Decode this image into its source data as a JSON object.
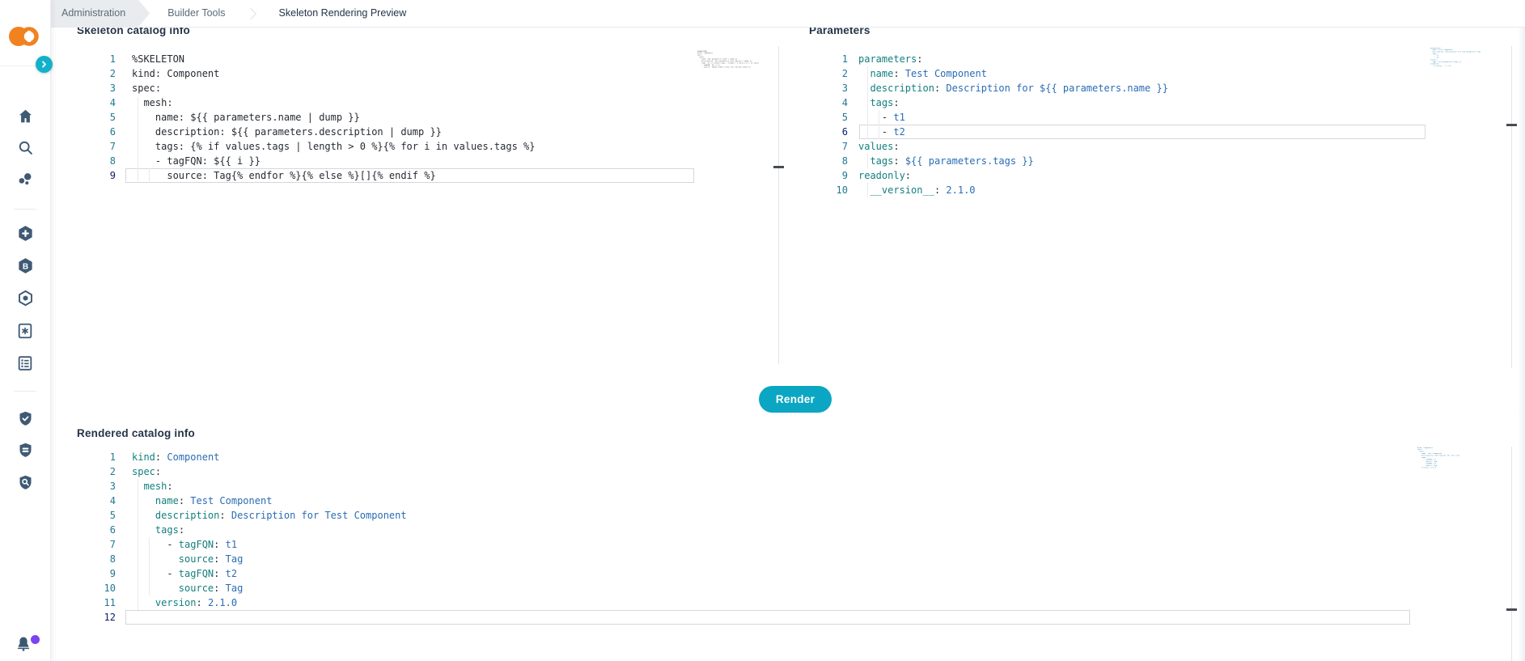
{
  "breadcrumb": {
    "items": [
      "Administration",
      "Builder Tools",
      "Skeleton Rendering Preview"
    ]
  },
  "sidebar": {
    "icons": [
      "logo",
      "collapse-chevron",
      "home",
      "search",
      "cluster",
      "hexagon-plus",
      "hexagon-b",
      "hexagon-outline",
      "card-gear",
      "card-list",
      "shield-check",
      "shield-data",
      "shield-search",
      "notifications-bell"
    ],
    "notification_dot_color": "#7c42f5"
  },
  "toolbar": {
    "render_label": "Render"
  },
  "colors": {
    "accent_teal": "#0ba6c3",
    "logo_orange": "#f08220",
    "yaml_key": "#147e7e",
    "yaml_value": "#2a6cb5",
    "plain_code": "#262b33",
    "line_number": "#237893",
    "active_line_number": "#0b216f"
  },
  "editors": {
    "skeleton": {
      "title": "Skeleton catalog info",
      "active_line": 9,
      "lines": [
        {
          "n": 1,
          "s": [
            [
              "p",
              "%SKELETON"
            ]
          ]
        },
        {
          "n": 2,
          "s": [
            [
              "p",
              "kind: Component"
            ]
          ]
        },
        {
          "n": 3,
          "s": [
            [
              "p",
              "spec:"
            ]
          ]
        },
        {
          "n": 4,
          "s": [
            [
              "p",
              "  mesh:"
            ]
          ]
        },
        {
          "n": 5,
          "s": [
            [
              "p",
              "    name: ${{ parameters.name | dump }}"
            ]
          ]
        },
        {
          "n": 6,
          "s": [
            [
              "p",
              "    description: ${{ parameters.description | dump }}"
            ]
          ]
        },
        {
          "n": 7,
          "s": [
            [
              "p",
              "    tags: {% if values.tags | length > 0 %}{% for i in values.tags %}"
            ]
          ]
        },
        {
          "n": 8,
          "s": [
            [
              "p",
              "    - tagFQN: ${{ i }}"
            ]
          ]
        },
        {
          "n": 9,
          "s": [
            [
              "p",
              "      source: Tag{% endfor %}{% else %}[]{% endif %}"
            ]
          ]
        }
      ]
    },
    "parameters": {
      "title": "Parameters",
      "active_line": 6,
      "lines": [
        {
          "n": 1,
          "s": [
            [
              "k",
              "parameters"
            ],
            [
              "p",
              ":"
            ]
          ]
        },
        {
          "n": 2,
          "s": [
            [
              "p",
              "  "
            ],
            [
              "k",
              "name"
            ],
            [
              "p",
              ":"
            ],
            [
              "v",
              " Test Component"
            ]
          ]
        },
        {
          "n": 3,
          "s": [
            [
              "p",
              "  "
            ],
            [
              "k",
              "description"
            ],
            [
              "p",
              ":"
            ],
            [
              "v",
              " Description for ${{ parameters.name }}"
            ]
          ]
        },
        {
          "n": 4,
          "s": [
            [
              "p",
              "  "
            ],
            [
              "k",
              "tags"
            ],
            [
              "p",
              ":"
            ]
          ]
        },
        {
          "n": 5,
          "s": [
            [
              "p",
              "    - "
            ],
            [
              "v",
              "t1"
            ]
          ]
        },
        {
          "n": 6,
          "s": [
            [
              "p",
              "    - "
            ],
            [
              "v",
              "t2"
            ]
          ]
        },
        {
          "n": 7,
          "s": [
            [
              "k",
              "values"
            ],
            [
              "p",
              ":"
            ]
          ]
        },
        {
          "n": 8,
          "s": [
            [
              "p",
              "  "
            ],
            [
              "k",
              "tags"
            ],
            [
              "p",
              ":"
            ],
            [
              "v",
              " ${{ parameters.tags }}"
            ]
          ]
        },
        {
          "n": 9,
          "s": [
            [
              "k",
              "readonly"
            ],
            [
              "p",
              ":"
            ]
          ]
        },
        {
          "n": 10,
          "s": [
            [
              "p",
              "  "
            ],
            [
              "k",
              "__version__"
            ],
            [
              "p",
              ":"
            ],
            [
              "v",
              " 2.1.0"
            ]
          ]
        }
      ]
    },
    "rendered": {
      "title": "Rendered catalog info",
      "active_line": 12,
      "lines": [
        {
          "n": 1,
          "s": [
            [
              "k",
              "kind"
            ],
            [
              "p",
              ":"
            ],
            [
              "v",
              " Component"
            ]
          ]
        },
        {
          "n": 2,
          "s": [
            [
              "k",
              "spec"
            ],
            [
              "p",
              ":"
            ]
          ]
        },
        {
          "n": 3,
          "s": [
            [
              "p",
              "  "
            ],
            [
              "k",
              "mesh"
            ],
            [
              "p",
              ":"
            ]
          ]
        },
        {
          "n": 4,
          "s": [
            [
              "p",
              "    "
            ],
            [
              "k",
              "name"
            ],
            [
              "p",
              ":"
            ],
            [
              "v",
              " Test Component"
            ]
          ]
        },
        {
          "n": 5,
          "s": [
            [
              "p",
              "    "
            ],
            [
              "k",
              "description"
            ],
            [
              "p",
              ":"
            ],
            [
              "v",
              " Description for Test Component"
            ]
          ]
        },
        {
          "n": 6,
          "s": [
            [
              "p",
              "    "
            ],
            [
              "k",
              "tags"
            ],
            [
              "p",
              ":"
            ]
          ]
        },
        {
          "n": 7,
          "s": [
            [
              "p",
              "      - "
            ],
            [
              "k",
              "tagFQN"
            ],
            [
              "p",
              ":"
            ],
            [
              "v",
              " t1"
            ]
          ]
        },
        {
          "n": 8,
          "s": [
            [
              "p",
              "        "
            ],
            [
              "k",
              "source"
            ],
            [
              "p",
              ":"
            ],
            [
              "v",
              " Tag"
            ]
          ]
        },
        {
          "n": 9,
          "s": [
            [
              "p",
              "      - "
            ],
            [
              "k",
              "tagFQN"
            ],
            [
              "p",
              ":"
            ],
            [
              "v",
              " t2"
            ]
          ]
        },
        {
          "n": 10,
          "s": [
            [
              "p",
              "        "
            ],
            [
              "k",
              "source"
            ],
            [
              "p",
              ":"
            ],
            [
              "v",
              " Tag"
            ]
          ]
        },
        {
          "n": 11,
          "s": [
            [
              "p",
              "    "
            ],
            [
              "k",
              "version"
            ],
            [
              "p",
              ":"
            ],
            [
              "v",
              " 2.1.0"
            ]
          ]
        },
        {
          "n": 12,
          "s": []
        }
      ]
    }
  }
}
